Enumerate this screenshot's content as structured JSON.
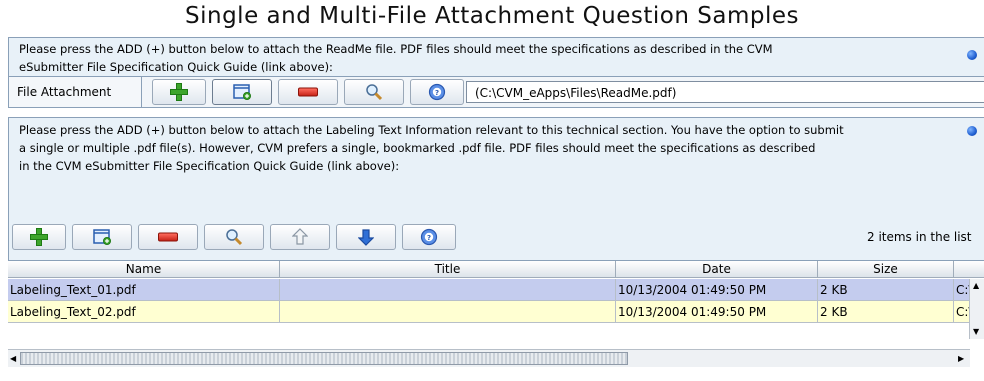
{
  "page_title": "Single and Multi-File Attachment Question Samples",
  "q1": {
    "text_line1": "Please press the ADD (+) button below to attach the ReadMe file. PDF files should meet the specifications as described in the CVM",
    "text_line2": "eSubmitter File Specification Quick Guide (link above):",
    "field_label": "File Attachment",
    "file_path": "(C:\\CVM_eApps\\Files\\ReadMe.pdf)"
  },
  "q2": {
    "text_line1": "Please press the ADD (+) button below to attach the Labeling Text Information relevant to this technical section. You have the option to submit",
    "text_line2": "a single or multiple .pdf file(s). However, CVM prefers a single, bookmarked .pdf file.  PDF files should meet the specifications as described",
    "text_line3": "in the CVM eSubmitter File Specification Quick Guide (link above):",
    "item_count": "2 items in the list"
  },
  "table": {
    "columns": [
      "Name",
      "Title",
      "Date",
      "Size",
      ""
    ],
    "rows": [
      {
        "name": "Labeling_Text_01.pdf",
        "title": "",
        "date": "10/13/2004 01:49:50 PM",
        "size": "2 KB",
        "path": "C:\\"
      },
      {
        "name": "Labeling_Text_02.pdf",
        "title": "",
        "date": "10/13/2004 01:49:50 PM",
        "size": "2 KB",
        "path": "C:\\"
      }
    ]
  },
  "icons": {
    "add": "plus-icon",
    "new": "new-document-icon",
    "remove": "minus-icon",
    "view": "magnifier-icon",
    "help": "help-icon",
    "up": "arrow-up-icon",
    "down": "arrow-down-icon",
    "info": "info-dot-icon"
  },
  "colors": {
    "panel_bg": "#e8f1f8",
    "selected_row": "#c4ccee",
    "alt_row": "#ffffd2",
    "add_green": "#3ea52c",
    "remove_red": "#c8251a",
    "up_down_blue": "#2f6fd6"
  }
}
